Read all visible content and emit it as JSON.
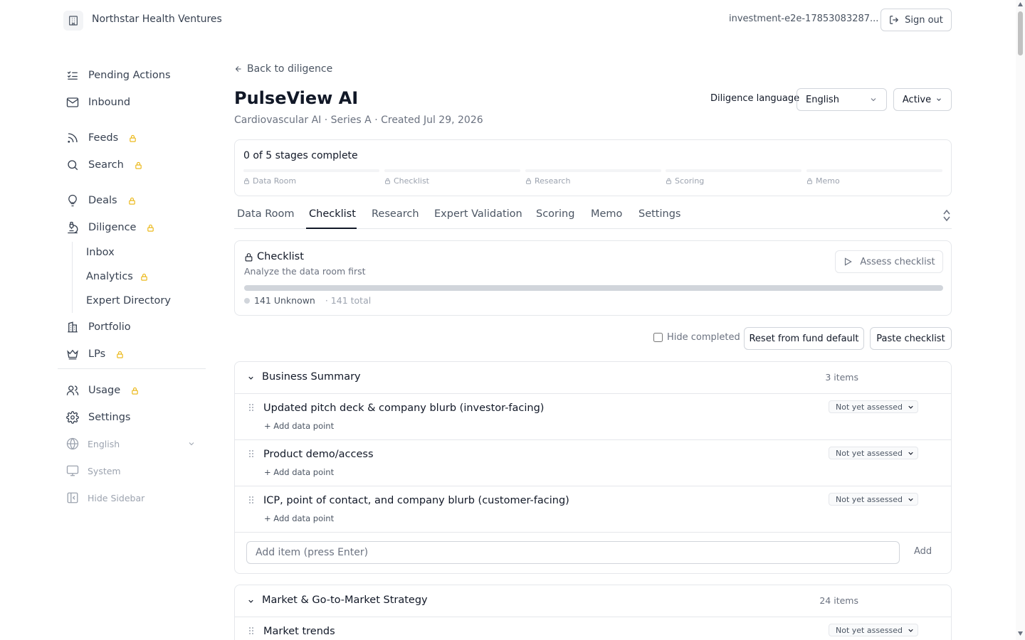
{
  "header": {
    "org_name": "Northstar Health Ventures",
    "user_email": "investment-e2e-17853083287...",
    "sign_out_label": "Sign out"
  },
  "sidebar": {
    "items": [
      {
        "label": "Pending Actions",
        "icon": "list-check-icon",
        "locked": false
      },
      {
        "label": "Inbound",
        "icon": "mail-icon",
        "locked": false
      },
      {
        "label": "Feeds",
        "icon": "rss-icon",
        "locked": true
      },
      {
        "label": "Search",
        "icon": "search-icon",
        "locked": true
      },
      {
        "label": "Deals",
        "icon": "lightbulb-icon",
        "locked": true
      },
      {
        "label": "Diligence",
        "icon": "microscope-icon",
        "locked": true
      }
    ],
    "diligence_sub": [
      {
        "label": "Inbox",
        "locked": false
      },
      {
        "label": "Analytics",
        "locked": true
      },
      {
        "label": "Expert Directory",
        "locked": false
      }
    ],
    "items2": [
      {
        "label": "Portfolio",
        "icon": "building-icon",
        "locked": false
      },
      {
        "label": "LPs",
        "icon": "crown-icon",
        "locked": true
      }
    ],
    "items3": [
      {
        "label": "Usage",
        "icon": "users-icon",
        "locked": true
      },
      {
        "label": "Settings",
        "icon": "gear-icon",
        "locked": false
      }
    ],
    "language_label": "English",
    "theme_label": "System",
    "hide_sidebar_label": "Hide Sidebar",
    "lock_color": "#eab308"
  },
  "page": {
    "back_label": "Back to diligence",
    "title": "PulseView AI",
    "subtitle": "Cardiovascular AI · Series A · Created Jul 29, 2026",
    "diligence_language_label": "Diligence language",
    "diligence_language_value": "English",
    "status_value": "Active"
  },
  "stages": {
    "summary": "0 of 5 stages complete",
    "items": [
      "Data Room",
      "Checklist",
      "Research",
      "Scoring",
      "Memo"
    ],
    "completed": 0
  },
  "tabs": [
    "Data Room",
    "Checklist",
    "Research",
    "Expert Validation",
    "Scoring",
    "Memo",
    "Settings"
  ],
  "active_tab": "Checklist",
  "checklist": {
    "title": "Checklist",
    "subtitle": "Analyze the data room first",
    "assess_label": "Assess checklist",
    "unknown_label": "141 Unknown",
    "total_label": "· 141 total",
    "hide_completed_label": "Hide completed",
    "hide_completed_checked": false,
    "reset_label": "Reset from fund default",
    "paste_label": "Paste checklist"
  },
  "sections": [
    {
      "title": "Business Summary",
      "count_label": "3 items",
      "items": [
        {
          "title": "Updated pitch deck & company blurb (investor-facing)",
          "status": "Not yet assessed",
          "add_label": "+ Add data point"
        },
        {
          "title": "Product demo/access",
          "status": "Not yet assessed",
          "add_label": "+ Add data point"
        },
        {
          "title": "ICP, point of contact, and company blurb (customer-facing)",
          "status": "Not yet assessed",
          "add_label": "+ Add data point"
        }
      ],
      "add_placeholder": "Add item (press Enter)",
      "add_button": "Add"
    },
    {
      "title": "Market & Go-to-Market Strategy",
      "count_label": "24 items",
      "items": [
        {
          "title": "Market trends",
          "status": "Not yet assessed",
          "add_label": "+ Add data point"
        }
      ]
    }
  ]
}
